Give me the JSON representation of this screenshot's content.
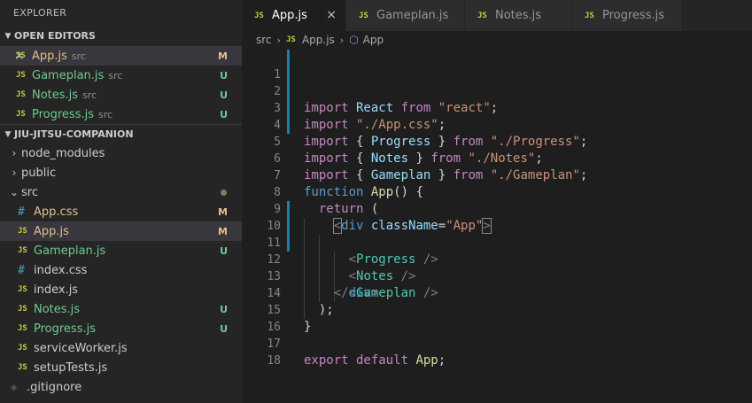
{
  "sidebar": {
    "title": "EXPLORER",
    "open_editors": {
      "header": "OPEN EDITORS",
      "items": [
        {
          "icon": "JS",
          "name": "App.js",
          "desc": "src",
          "status": "M"
        },
        {
          "icon": "JS",
          "name": "Gameplan.js",
          "desc": "src",
          "status": "U"
        },
        {
          "icon": "JS",
          "name": "Notes.js",
          "desc": "src",
          "status": "U"
        },
        {
          "icon": "JS",
          "name": "Progress.js",
          "desc": "src",
          "status": "U"
        }
      ]
    },
    "project": {
      "header": "JIU-JITSU-COMPANION",
      "folders": [
        {
          "chevron": "›",
          "name": "node_modules"
        },
        {
          "chevron": "›",
          "name": "public"
        },
        {
          "chevron": "⌄",
          "name": "src"
        }
      ],
      "src_files": [
        {
          "icon": "#",
          "name": "App.css",
          "status": "M"
        },
        {
          "icon": "JS",
          "name": "App.js",
          "status": "M"
        },
        {
          "icon": "JS",
          "name": "Gameplan.js",
          "status": "U"
        },
        {
          "icon": "#",
          "name": "index.css",
          "status": ""
        },
        {
          "icon": "JS",
          "name": "index.js",
          "status": ""
        },
        {
          "icon": "JS",
          "name": "Notes.js",
          "status": "U"
        },
        {
          "icon": "JS",
          "name": "Progress.js",
          "status": "U"
        },
        {
          "icon": "JS",
          "name": "serviceWorker.js",
          "status": ""
        },
        {
          "icon": "JS",
          "name": "setupTests.js",
          "status": ""
        }
      ],
      "root_files": [
        {
          "icon": "◆",
          "name": ".gitignore"
        }
      ]
    }
  },
  "tabs": [
    {
      "icon": "JS",
      "label": "App.js",
      "close": "×"
    },
    {
      "icon": "JS",
      "label": "Gameplan.js"
    },
    {
      "icon": "JS",
      "label": "Notes.js"
    },
    {
      "icon": "JS",
      "label": "Progress.js"
    }
  ],
  "breadcrumb": {
    "folder": "src",
    "file_icon": "JS",
    "file": "App.js",
    "symbol_icon": "⬡",
    "symbol": "App"
  },
  "code": {
    "line_numbers": [
      "1",
      "2",
      "3",
      "4",
      "5",
      "6",
      "7",
      "8",
      "9",
      "10",
      "11",
      "12",
      "13",
      "14",
      "15",
      "16",
      "17",
      "18"
    ],
    "l1": {
      "kw": "import",
      "id": " React ",
      "from": "from",
      "str": " \"react\"",
      "end": ";"
    },
    "l2": {
      "kw": "import",
      "str": " \"./App.css\"",
      "end": ";"
    },
    "l3": {
      "kw": "import",
      "open": " { ",
      "id": "Progress",
      "close": " } ",
      "from": "from",
      "str": " \"./Progress\"",
      "end": ";"
    },
    "l4": {
      "kw": "import",
      "open": " { ",
      "id": "Notes",
      "close": " } ",
      "from": "from",
      "str": " \"./Notes\"",
      "end": ";"
    },
    "l5": {
      "kw": "import",
      "open": " { ",
      "id": "Gameplan",
      "close": " } ",
      "from": "from",
      "str": " \"./Gameplan\"",
      "end": ";"
    },
    "l7": {
      "kw": "function",
      "name": " App",
      "rest": "() {"
    },
    "l8": {
      "kw": "return",
      "rest": " ("
    },
    "l9": {
      "lt": "<",
      "tag": "div",
      "attr": " className",
      "eq": "=",
      "val": "\"App\"",
      "gt": ">"
    },
    "l10": {
      "lt": "<",
      "tag": "Progress",
      "end": " />"
    },
    "l11": {
      "lt": "<",
      "tag": "Notes",
      "end": " />"
    },
    "l12": {
      "lt": "<",
      "tag": "Gameplan",
      "end": " />"
    },
    "l13": {
      "lt": "</",
      "tag": "div",
      "gt": ">"
    },
    "l14": {
      "text": ");"
    },
    "l15": {
      "text": "}"
    },
    "l17": {
      "kw": "export default",
      "name": " App",
      "end": ";"
    }
  },
  "colors": {
    "accent": "#1b81a8",
    "modified": "#e2c08d",
    "untracked": "#73c991"
  }
}
